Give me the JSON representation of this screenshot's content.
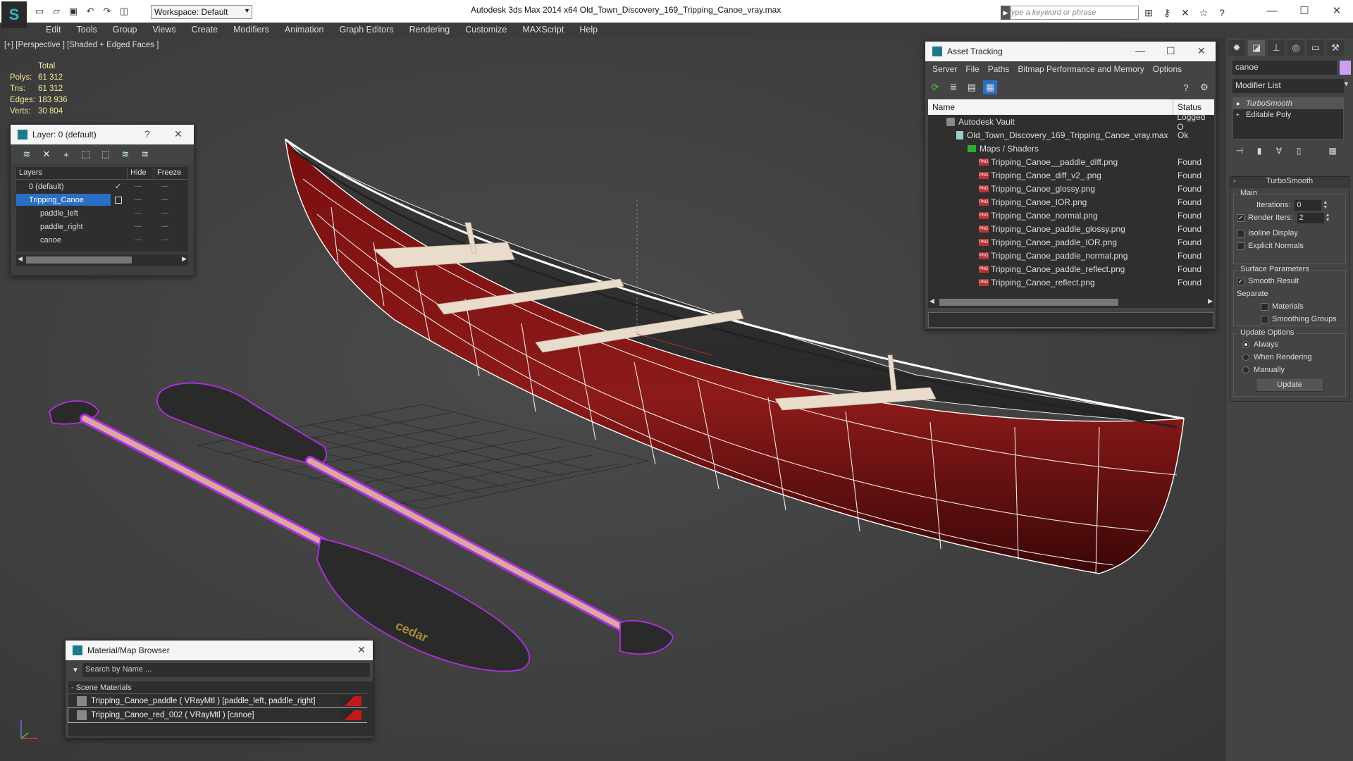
{
  "titlebar": {
    "workspace": "Workspace: Default",
    "window_title": "Autodesk 3ds Max  2014 x64       Old_Town_Discovery_169_Tripping_Canoe_vray.max",
    "search_placeholder": "Type a keyword or phrase"
  },
  "menu": [
    "Edit",
    "Tools",
    "Group",
    "Views",
    "Create",
    "Modifiers",
    "Animation",
    "Graph Editors",
    "Rendering",
    "Customize",
    "MAXScript",
    "Help"
  ],
  "viewport": {
    "label": "[+] [Perspective ] [Shaded + Edged Faces ]",
    "stats": {
      "total_label": "Total",
      "rows": [
        {
          "k": "Polys:",
          "v": "61 312"
        },
        {
          "k": "Tris:",
          "v": "61 312"
        },
        {
          "k": "Edges:",
          "v": "183 936"
        },
        {
          "k": "Verts:",
          "v": "30 804"
        }
      ]
    },
    "paddle_brand": "cedar"
  },
  "layer_panel": {
    "title": "Layer: 0 (default)",
    "help": "?",
    "columns": [
      "Layers",
      "Hide",
      "Freeze"
    ],
    "rows": [
      {
        "name": "0 (default)",
        "indent": 0
      },
      {
        "name": "Tripping_Canoe",
        "indent": 0
      },
      {
        "name": "paddle_left",
        "indent": 1
      },
      {
        "name": "paddle_right",
        "indent": 1
      },
      {
        "name": "canoe",
        "indent": 1
      }
    ]
  },
  "asset_panel": {
    "title": "Asset Tracking",
    "menu": [
      "Server",
      "File",
      "Paths",
      "Bitmap Performance and Memory",
      "Options"
    ],
    "columns": [
      "Name",
      "Status"
    ],
    "rows": [
      {
        "name": "Autodesk Vault",
        "status": "Logged O",
        "kind": "vault",
        "indent": 1
      },
      {
        "name": "Old_Town_Discovery_169_Tripping_Canoe_vray.max",
        "status": "Ok",
        "kind": "file",
        "indent": 2
      },
      {
        "name": "Maps / Shaders",
        "status": "",
        "kind": "maps",
        "indent": 3
      },
      {
        "name": "Tripping_Canoe__paddle_diff.png",
        "status": "Found",
        "kind": "png",
        "indent": 4
      },
      {
        "name": "Tripping_Canoe_diff_v2_.png",
        "status": "Found",
        "kind": "png",
        "indent": 4
      },
      {
        "name": "Tripping_Canoe_glossy.png",
        "status": "Found",
        "kind": "png",
        "indent": 4
      },
      {
        "name": "Tripping_Canoe_IOR.png",
        "status": "Found",
        "kind": "png",
        "indent": 4
      },
      {
        "name": "Tripping_Canoe_normal.png",
        "status": "Found",
        "kind": "png",
        "indent": 4
      },
      {
        "name": "Tripping_Canoe_paddle_glossy.png",
        "status": "Found",
        "kind": "png",
        "indent": 4
      },
      {
        "name": "Tripping_Canoe_paddle_IOR.png",
        "status": "Found",
        "kind": "png",
        "indent": 4
      },
      {
        "name": "Tripping_Canoe_paddle_normal.png",
        "status": "Found",
        "kind": "png",
        "indent": 4
      },
      {
        "name": "Tripping_Canoe_paddle_reflect.png",
        "status": "Found",
        "kind": "png",
        "indent": 4
      },
      {
        "name": "Tripping_Canoe_reflect.png",
        "status": "Found",
        "kind": "png",
        "indent": 4
      }
    ]
  },
  "command_panel": {
    "object_name": "canoe",
    "object_color": "#c8a2f0",
    "modifier_list": "Modifier List",
    "stack": [
      "TurboSmooth",
      "Editable Poly"
    ],
    "turbosmooth": {
      "title": "TurboSmooth",
      "main_label": "Main",
      "iterations_label": "Iterations:",
      "iterations": "0",
      "render_iters_label": "Render Iters:",
      "render_iters": "2",
      "isoline": "Isoline Display",
      "explicit": "Explicit Normals",
      "surface_label": "Surface Parameters",
      "smooth_result": "Smooth Result",
      "separate_label": "Separate",
      "materials": "Materials",
      "smoothing_groups": "Smoothing Groups",
      "update_label": "Update Options",
      "always": "Always",
      "when_rendering": "When Rendering",
      "manually": "Manually",
      "update_button": "Update"
    }
  },
  "material_browser": {
    "title": "Material/Map Browser",
    "search_placeholder": "Search by Name ...",
    "category": "- Scene Materials",
    "items": [
      "Tripping_Canoe_paddle ( VRayMtl ) [paddle_left, paddle_right]",
      "Tripping_Canoe_red_002  ( VRayMtl ) [canoe]"
    ]
  },
  "colors": {
    "canoe_red": "#8a1515",
    "paddle_wire": "#b030e0",
    "selection_blue": "#2b6fc4",
    "stats_yellow": "#f3e89a"
  }
}
